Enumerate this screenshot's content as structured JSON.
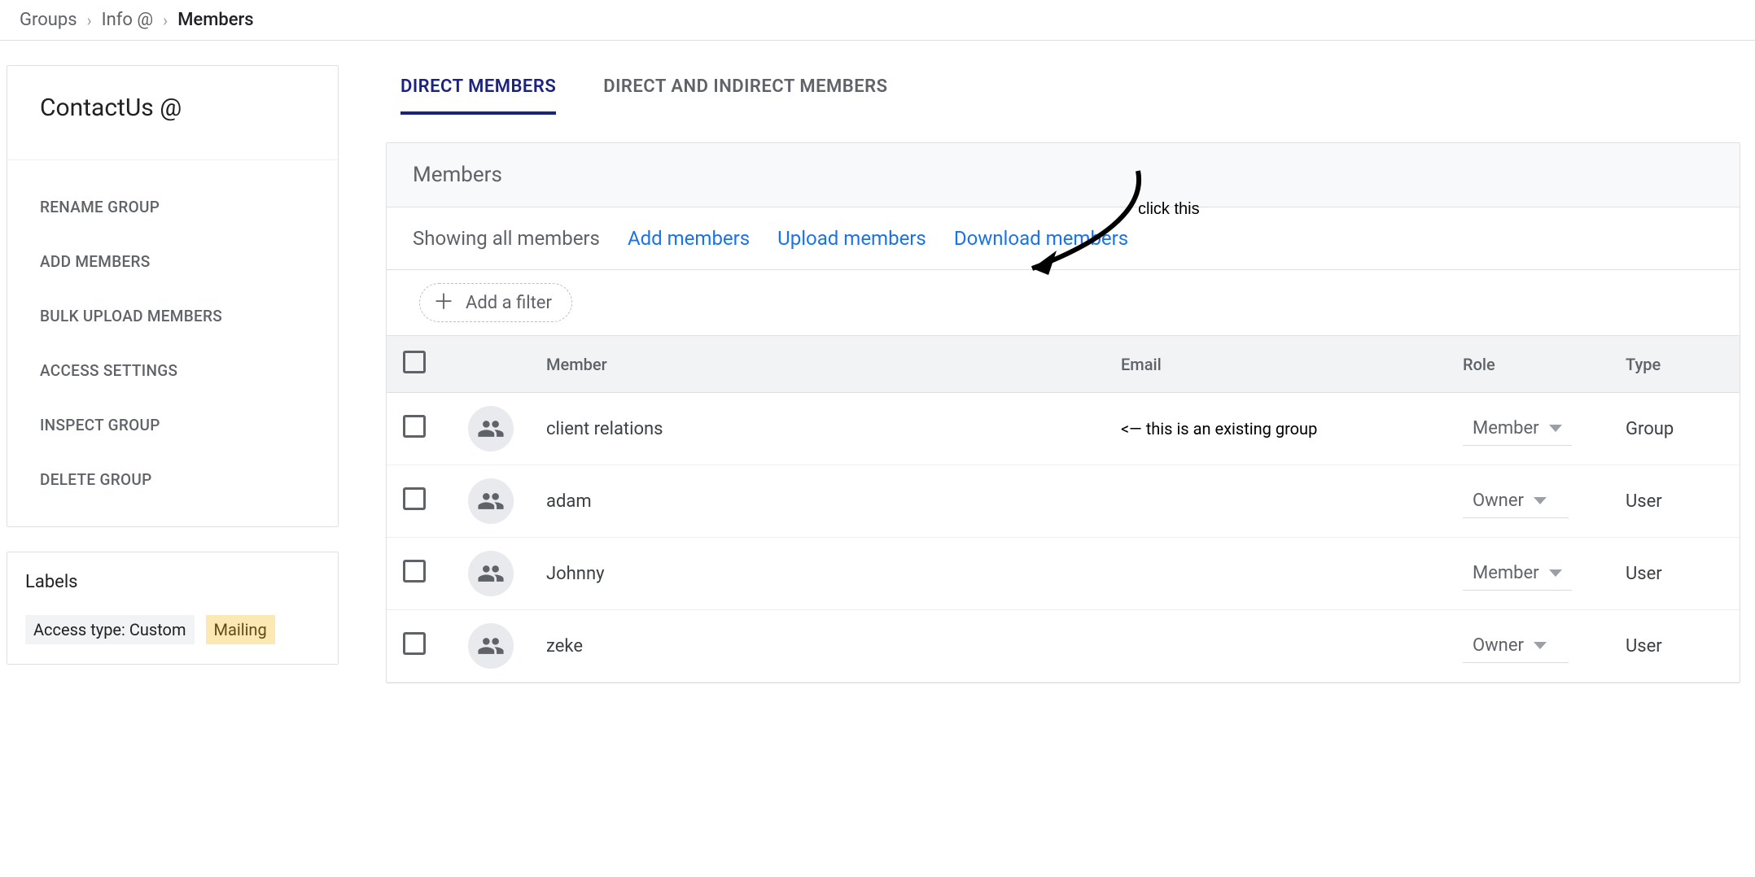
{
  "breadcrumb": {
    "groups": "Groups",
    "info": "Info @",
    "current": "Members"
  },
  "sidebar": {
    "group_name": "ContactUs @",
    "nav": [
      "RENAME GROUP",
      "ADD MEMBERS",
      "BULK UPLOAD MEMBERS",
      "ACCESS SETTINGS",
      "INSPECT GROUP",
      "DELETE GROUP"
    ],
    "labels_title": "Labels",
    "labels": {
      "access": "Access type: Custom",
      "mailing": "Mailing"
    }
  },
  "tabs": {
    "direct": "DIRECT MEMBERS",
    "indirect": "DIRECT AND INDIRECT MEMBERS"
  },
  "panel": {
    "title": "Members",
    "showing": "Showing all members",
    "add": "Add members",
    "upload": "Upload members",
    "download": "Download members",
    "filter": "Add a filter"
  },
  "table": {
    "headers": {
      "member": "Member",
      "email": "Email",
      "role": "Role",
      "type": "Type"
    },
    "rows": [
      {
        "name": "client relations",
        "email_note": "<— this is an existing group",
        "role": "Member",
        "type": "Group"
      },
      {
        "name": "adam",
        "email_note": "",
        "role": "Owner",
        "type": "User"
      },
      {
        "name": "Johnny",
        "email_note": "",
        "role": "Member",
        "type": "User"
      },
      {
        "name": "zeke",
        "email_note": "",
        "role": "Owner",
        "type": "User"
      }
    ]
  },
  "annotation": {
    "click_this": "click this"
  }
}
